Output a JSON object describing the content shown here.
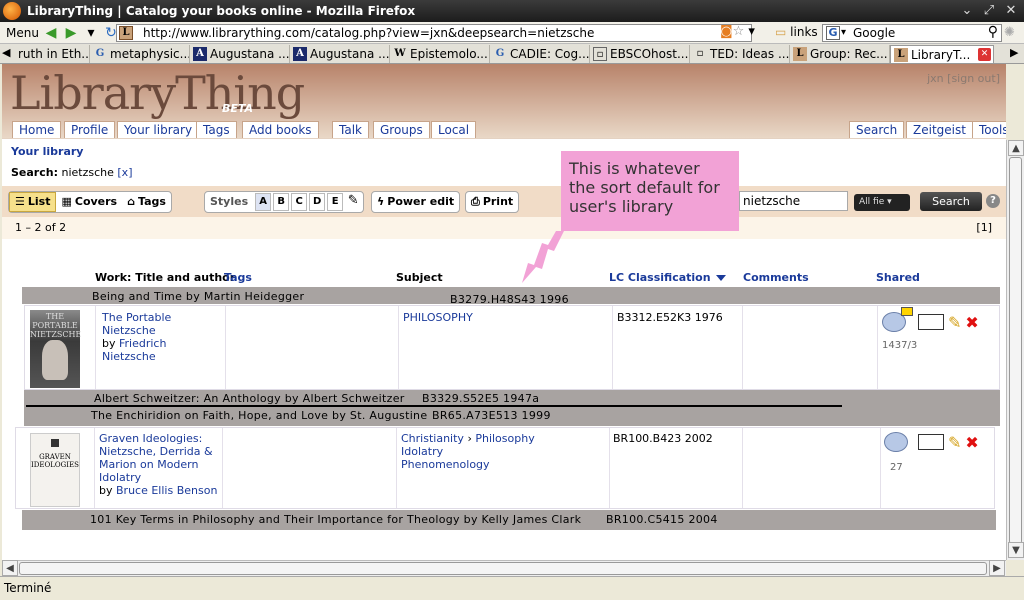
{
  "window": {
    "title": "LibraryThing | Catalog your books online - Mozilla Firefox"
  },
  "navbar": {
    "menu_label": "Menu",
    "url": "http://www.librarything.com/catalog.php?view=jxn&deepsearch=nietzsche",
    "links_label": "links",
    "search_engine": "Google"
  },
  "browser_tabs": [
    {
      "label": "ruth in Eth..."
    },
    {
      "label": "metaphysic..."
    },
    {
      "label": "Augustana ..."
    },
    {
      "label": "Augustana ..."
    },
    {
      "label": "Epistemolo..."
    },
    {
      "label": "CADIE: Cog..."
    },
    {
      "label": "EBSCOhost..."
    },
    {
      "label": "TED: Ideas ..."
    },
    {
      "label": "Group: Rec..."
    },
    {
      "label": "LibraryT..."
    }
  ],
  "site": {
    "logo": "LibraryThing",
    "beta": "BETA",
    "user": "jxn",
    "signout": "[sign out]",
    "nav_left": [
      "Home",
      "Profile",
      "Your library",
      "Tags",
      "Add books"
    ],
    "nav_mid": [
      "Talk",
      "Groups",
      "Local"
    ],
    "nav_right": [
      "Search",
      "Zeitgeist",
      "Tools"
    ]
  },
  "library": {
    "heading": "Your library",
    "search_label": "Search:",
    "search_term": "nietzsche",
    "search_clear": "[x]",
    "count": "1 – 2 of 2",
    "page": "[1]"
  },
  "toolbar": {
    "views": [
      "List",
      "Covers",
      "Tags"
    ],
    "styles_label": "Styles",
    "style_letters": [
      "A",
      "B",
      "C",
      "D",
      "E"
    ],
    "power_edit": "Power edit",
    "print": "Print",
    "search_value": "nietzsche",
    "field_select": "All fie",
    "search_button": "Search",
    "help": "?"
  },
  "columns": {
    "work": "Work: Title and author",
    "tags": "Tags",
    "subject": "Subject",
    "lc": "LC Classification",
    "comments": "Comments",
    "shared": "Shared"
  },
  "gray_rows": [
    {
      "title": "Being and Time by Martin Heidegger",
      "lc": "B3279.H48S43 1996"
    },
    {
      "title": "Albert Schweitzer: An Anthology by Albert Schweitzer",
      "lc": "B3329.S52E5 1947a"
    },
    {
      "title": "The Enchiridion on Faith, Hope, and Love by St. Augustine",
      "lc": "BR65.A73E513 1999"
    },
    {
      "title": "101 Key Terms in Philosophy and Their Importance for Theology by Kelly James Clark",
      "lc": "BR100.C5415 2004"
    }
  ],
  "books": [
    {
      "cover_text": "THE PORTABLE NIETZSCHE",
      "title": "The Portable Nietzsche",
      "by": "by",
      "author": "Friedrich Nietzsche",
      "subjects": [
        "PHILOSOPHY"
      ],
      "lc": "B3312.E52K3 1976",
      "shared_count": "1437/3"
    },
    {
      "cover_text": "GRAVEN IDEOLOGIES",
      "title": "Graven Ideologies: Nietzsche, Derrida & Marion on Modern Idolatry",
      "by": "by",
      "author": "Bruce Ellis Benson",
      "subjects": [
        "Christianity",
        "Philosophy",
        "Idolatry",
        "Phenomenology"
      ],
      "subject_sep": "›",
      "lc": "BR100.B423 2002",
      "shared_count": "27"
    }
  ],
  "callout": {
    "text": "This is whatever the sort default for user's library"
  },
  "status": {
    "text": "Terminé"
  },
  "colors": {
    "link": "#1a3a9a",
    "header_brown": "#b8836a",
    "gray_row": "#a8a3a1",
    "callout_pink": "#f2a2d6",
    "toolbar_tan": "#f1dcc7"
  }
}
